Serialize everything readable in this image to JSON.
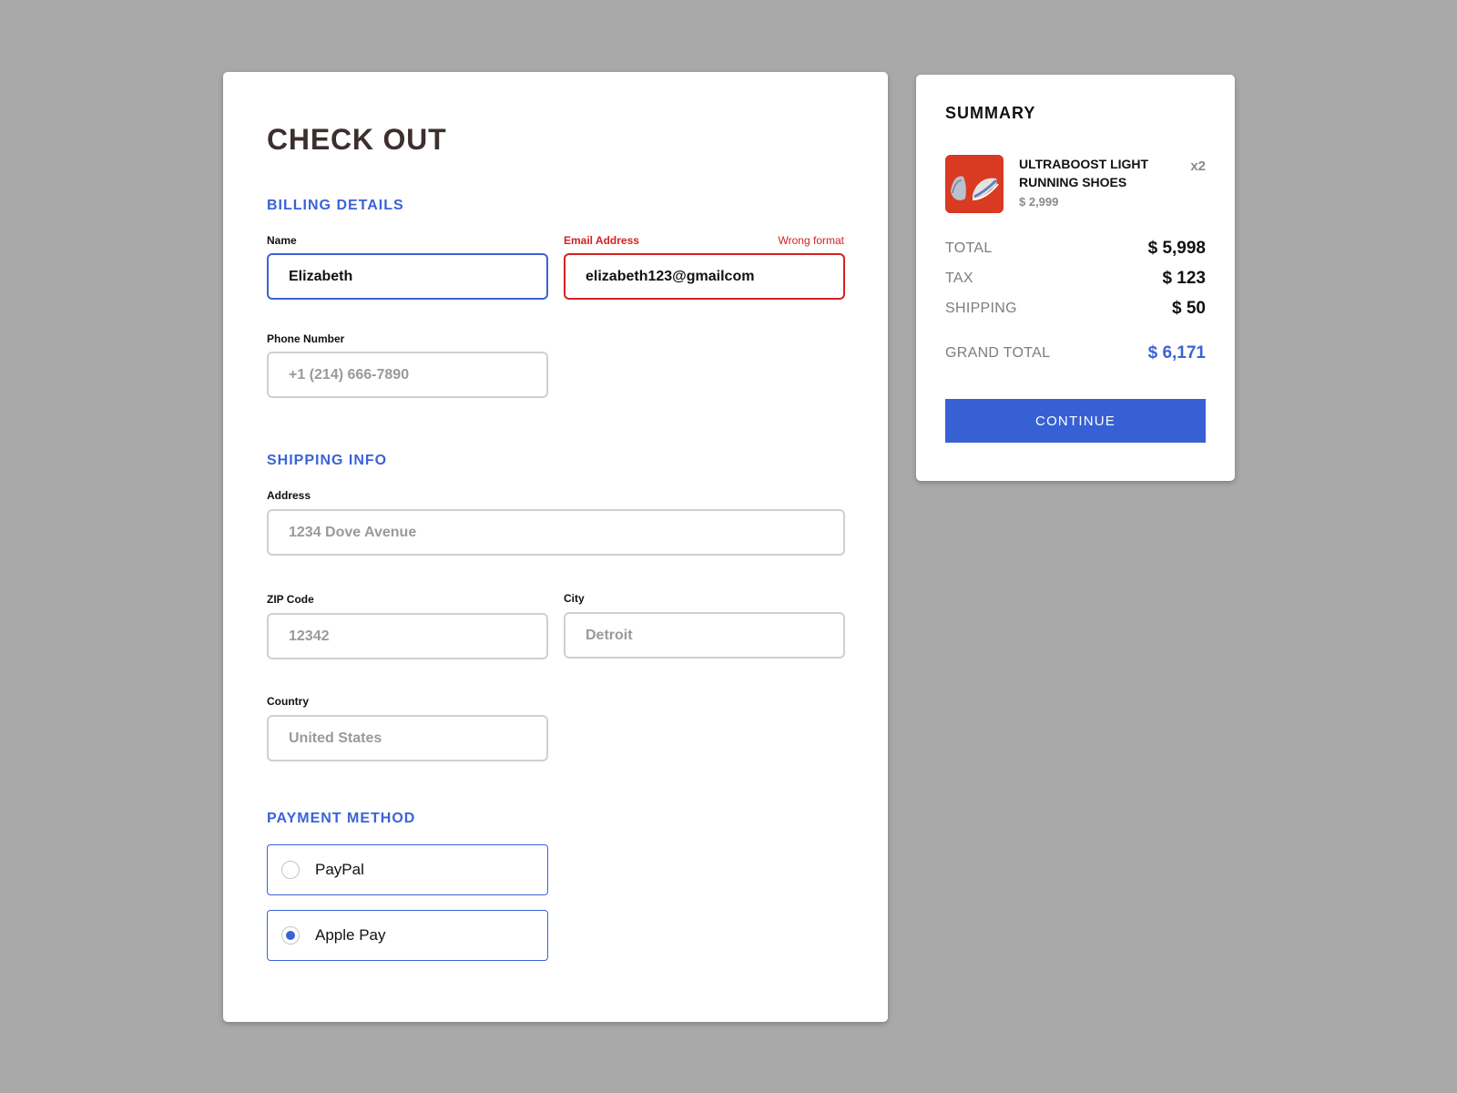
{
  "checkout": {
    "title": "CHECK OUT",
    "billing": {
      "heading": "BILLING DETAILS",
      "name_label": "Name",
      "name_value": "Elizabeth",
      "email_label": "Email Address",
      "email_error": "Wrong format",
      "email_value": "elizabeth123@gmailcom",
      "phone_label": "Phone Number",
      "phone_placeholder": "+1 (214) 666-7890"
    },
    "shipping": {
      "heading": "SHIPPING INFO",
      "address_label": "Address",
      "address_placeholder": "1234 Dove Avenue",
      "zip_label": "ZIP Code",
      "zip_placeholder": "12342",
      "city_label": "City",
      "city_placeholder": "Detroit",
      "country_label": "Country",
      "country_placeholder": "United States"
    },
    "payment": {
      "heading": "PAYMENT METHOD",
      "options": [
        {
          "label": "PayPal",
          "selected": false
        },
        {
          "label": "Apple Pay",
          "selected": true
        }
      ]
    }
  },
  "summary": {
    "title": "SUMMARY",
    "product": {
      "name": "ULTRABOOST LIGHT RUNNING SHOES",
      "price": "$ 2,999",
      "quantity": "x2",
      "image_icon": "shoe-image"
    },
    "rows": [
      {
        "label": "TOTAL",
        "value": "$ 5,998"
      },
      {
        "label": "TAX",
        "value": "$ 123"
      },
      {
        "label": "SHIPPING",
        "value": "$ 50"
      }
    ],
    "grand_total_label": "GRAND TOTAL",
    "grand_total_value": "$ 6,171",
    "continue_label": "CONTINUE"
  },
  "colors": {
    "background": "#a9a9a9",
    "accent": "#3a63d6",
    "error": "#d32222",
    "title": "#3d2f2f"
  }
}
